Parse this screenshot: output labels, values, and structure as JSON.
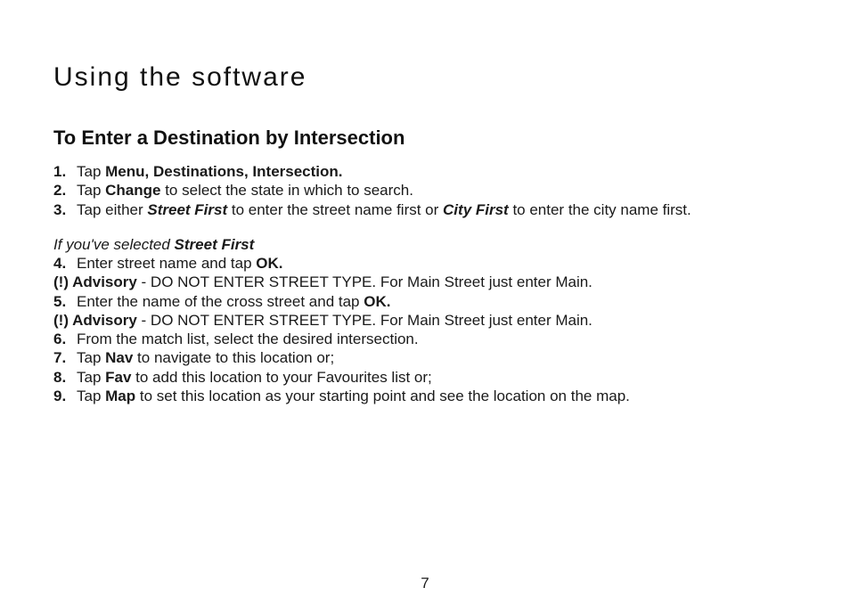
{
  "title": "Using the software",
  "section": "To Enter a Destination by Intersection",
  "lines": [
    {
      "type": "step",
      "num": "1.",
      "segs": [
        {
          "t": "Tap "
        },
        {
          "t": "Menu, Destinations, Intersection.",
          "b": true
        }
      ]
    },
    {
      "type": "step",
      "num": "2.",
      "segs": [
        {
          "t": "Tap "
        },
        {
          "t": "Change",
          "b": true
        },
        {
          "t": " to select the state in which to search."
        }
      ]
    },
    {
      "type": "step",
      "num": "3.",
      "segs": [
        {
          "t": "Tap either "
        },
        {
          "t": "Street First",
          "b": true,
          "i": true
        },
        {
          "t": " to enter the street name first or "
        },
        {
          "t": "City First",
          "b": true,
          "i": true
        },
        {
          "t": " to enter the city name first."
        }
      ]
    },
    {
      "type": "spacer"
    },
    {
      "type": "plain",
      "segs": [
        {
          "t": "If you've selected ",
          "i": true
        },
        {
          "t": "Street First",
          "b": true,
          "i": true
        }
      ]
    },
    {
      "type": "step",
      "num": "4.",
      "segs": [
        {
          "t": "Enter street name and tap "
        },
        {
          "t": "OK.",
          "b": true
        }
      ]
    },
    {
      "type": "plain",
      "segs": [
        {
          "t": "(!) Advisory",
          "b": true
        },
        {
          "t": " - DO NOT ENTER STREET TYPE. For Main Street just enter Main."
        }
      ]
    },
    {
      "type": "step",
      "num": "5.",
      "segs": [
        {
          "t": "Enter the name of the cross street and tap "
        },
        {
          "t": "OK.",
          "b": true
        }
      ]
    },
    {
      "type": "plain",
      "segs": [
        {
          "t": "(!) Advisory",
          "b": true
        },
        {
          "t": " - DO NOT ENTER STREET TYPE. For Main Street just enter Main."
        }
      ]
    },
    {
      "type": "step",
      "num": "6.",
      "segs": [
        {
          "t": "From the match list, select the desired intersection."
        }
      ]
    },
    {
      "type": "step",
      "num": "7.",
      "segs": [
        {
          "t": "Tap "
        },
        {
          "t": "Nav",
          "b": true
        },
        {
          "t": " to navigate to this location or;"
        }
      ]
    },
    {
      "type": "step",
      "num": "8.",
      "segs": [
        {
          "t": "Tap "
        },
        {
          "t": "Fav",
          "b": true
        },
        {
          "t": " to add this location to your Favourites list or;"
        }
      ]
    },
    {
      "type": "step",
      "num": "9.",
      "segs": [
        {
          "t": "Tap "
        },
        {
          "t": "Map",
          "b": true
        },
        {
          "t": " to set this location as your starting point and see the location on the map."
        }
      ]
    }
  ],
  "page_number": "7"
}
